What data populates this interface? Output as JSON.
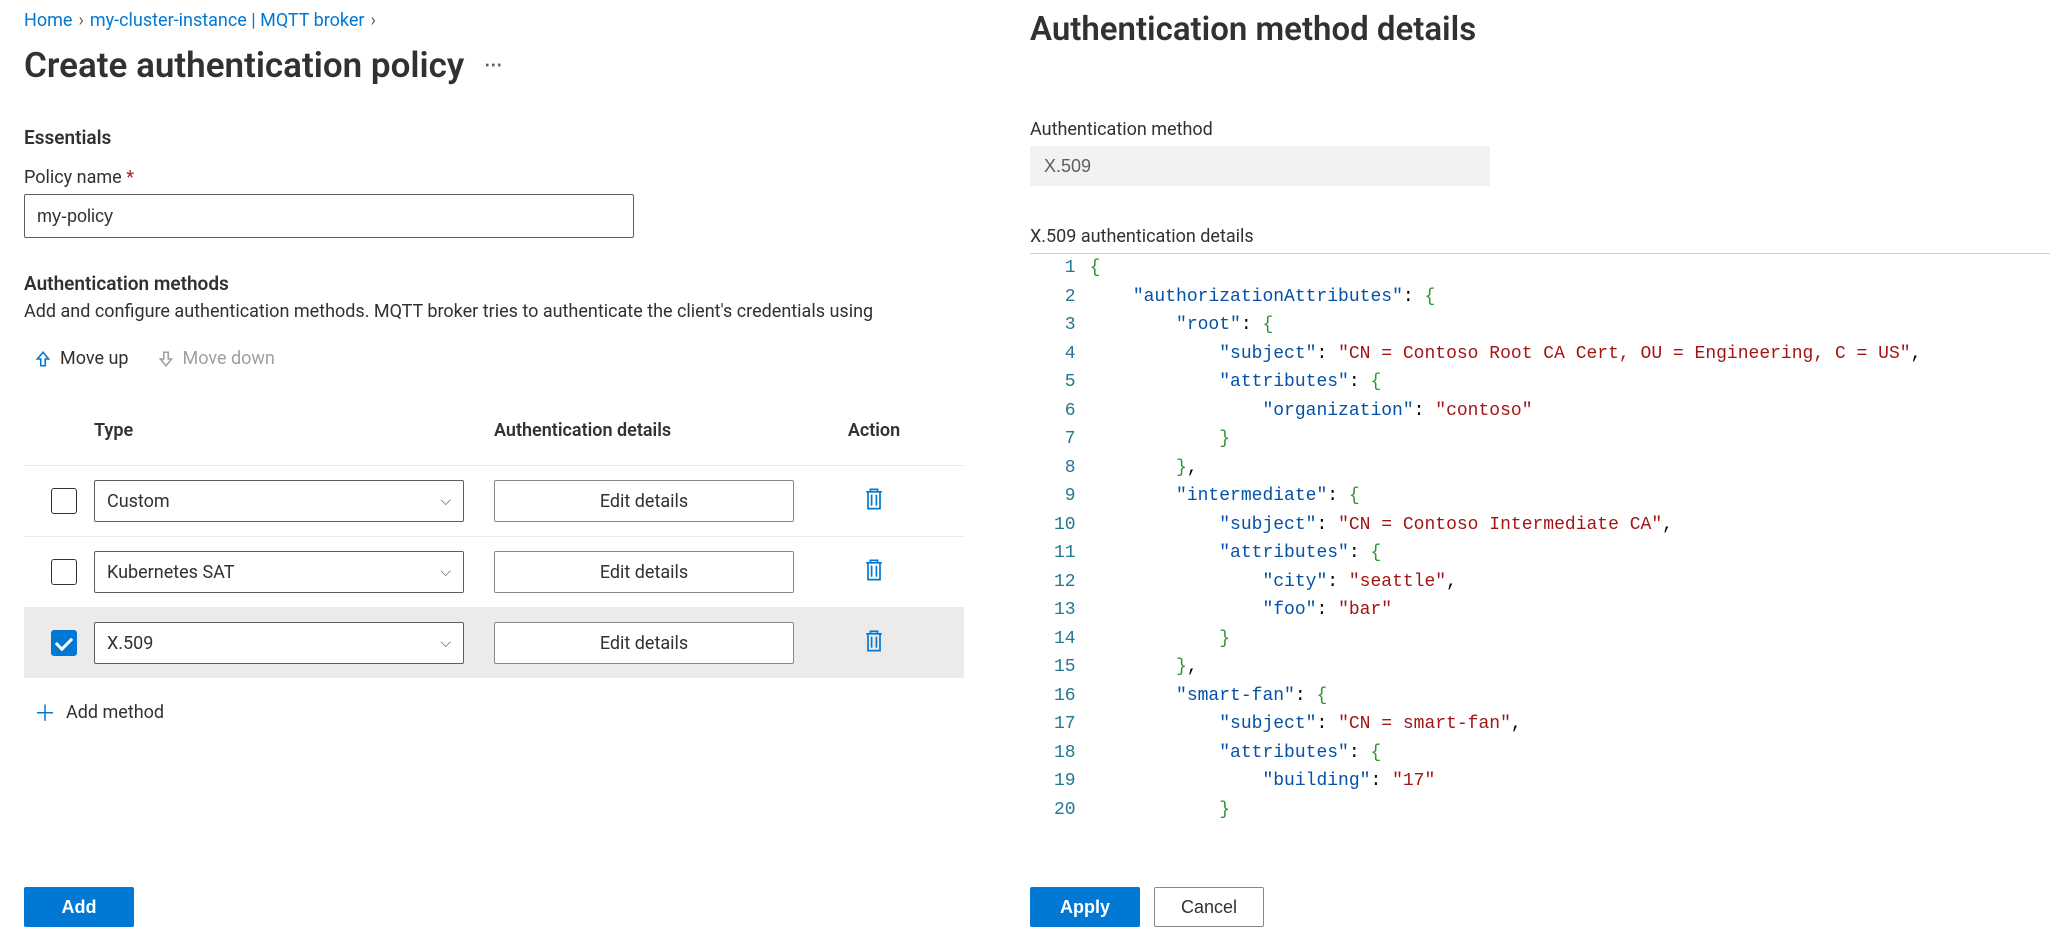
{
  "breadcrumb": {
    "home": "Home",
    "cluster": "my-cluster-instance | MQTT broker"
  },
  "page_title": "Create authentication policy",
  "essentials_heading": "Essentials",
  "policy_name_label": "Policy name",
  "policy_name_value": "my-policy",
  "auth_methods_heading": "Authentication methods",
  "auth_methods_helper": "Add and configure authentication methods. MQTT broker tries to authenticate the client's credentials using",
  "move_up_label": "Move up",
  "move_down_label": "Move down",
  "grid": {
    "col_type": "Type",
    "col_details": "Authentication details",
    "col_action": "Action",
    "edit_details": "Edit details",
    "rows": [
      {
        "type": "Custom",
        "checked": false
      },
      {
        "type": "Kubernetes SAT",
        "checked": false
      },
      {
        "type": "X.509",
        "checked": true
      }
    ]
  },
  "add_method_label": "Add method",
  "add_button": "Add",
  "right": {
    "title": "Authentication method details",
    "method_label": "Authentication method",
    "method_value": "X.509",
    "details_label": "X.509 authentication details",
    "apply": "Apply",
    "cancel": "Cancel",
    "json_lines": [
      [
        [
          "brace",
          "{"
        ]
      ],
      [
        [
          "indent",
          1
        ],
        [
          "key",
          "\"authorizationAttributes\""
        ],
        [
          "punc",
          ": "
        ],
        [
          "brace",
          "{"
        ]
      ],
      [
        [
          "indent",
          2
        ],
        [
          "key",
          "\"root\""
        ],
        [
          "punc",
          ": "
        ],
        [
          "brace",
          "{"
        ]
      ],
      [
        [
          "indent",
          3
        ],
        [
          "key",
          "\"subject\""
        ],
        [
          "punc",
          ": "
        ],
        [
          "str",
          "\"CN = Contoso Root CA Cert, OU = Engineering, C = US\""
        ],
        [
          "punc",
          ","
        ]
      ],
      [
        [
          "indent",
          3
        ],
        [
          "key",
          "\"attributes\""
        ],
        [
          "punc",
          ": "
        ],
        [
          "brace",
          "{"
        ]
      ],
      [
        [
          "indent",
          4
        ],
        [
          "key",
          "\"organization\""
        ],
        [
          "punc",
          ": "
        ],
        [
          "str",
          "\"contoso\""
        ]
      ],
      [
        [
          "indent",
          3
        ],
        [
          "brace",
          "}"
        ]
      ],
      [
        [
          "indent",
          2
        ],
        [
          "brace",
          "}"
        ],
        [
          "punc",
          ","
        ]
      ],
      [
        [
          "indent",
          2
        ],
        [
          "key",
          "\"intermediate\""
        ],
        [
          "punc",
          ": "
        ],
        [
          "brace",
          "{"
        ]
      ],
      [
        [
          "indent",
          3
        ],
        [
          "key",
          "\"subject\""
        ],
        [
          "punc",
          ": "
        ],
        [
          "str",
          "\"CN = Contoso Intermediate CA\""
        ],
        [
          "punc",
          ","
        ]
      ],
      [
        [
          "indent",
          3
        ],
        [
          "key",
          "\"attributes\""
        ],
        [
          "punc",
          ": "
        ],
        [
          "brace",
          "{"
        ]
      ],
      [
        [
          "indent",
          4
        ],
        [
          "key",
          "\"city\""
        ],
        [
          "punc",
          ": "
        ],
        [
          "str",
          "\"seattle\""
        ],
        [
          "punc",
          ","
        ]
      ],
      [
        [
          "indent",
          4
        ],
        [
          "key",
          "\"foo\""
        ],
        [
          "punc",
          ": "
        ],
        [
          "str",
          "\"bar\""
        ]
      ],
      [
        [
          "indent",
          3
        ],
        [
          "brace",
          "}"
        ]
      ],
      [
        [
          "indent",
          2
        ],
        [
          "brace",
          "}"
        ],
        [
          "punc",
          ","
        ]
      ],
      [
        [
          "indent",
          2
        ],
        [
          "key",
          "\"smart-fan\""
        ],
        [
          "punc",
          ": "
        ],
        [
          "brace",
          "{"
        ]
      ],
      [
        [
          "indent",
          3
        ],
        [
          "key",
          "\"subject\""
        ],
        [
          "punc",
          ": "
        ],
        [
          "str",
          "\"CN = smart-fan\""
        ],
        [
          "punc",
          ","
        ]
      ],
      [
        [
          "indent",
          3
        ],
        [
          "key",
          "\"attributes\""
        ],
        [
          "punc",
          ": "
        ],
        [
          "brace",
          "{"
        ]
      ],
      [
        [
          "indent",
          4
        ],
        [
          "key",
          "\"building\""
        ],
        [
          "punc",
          ": "
        ],
        [
          "str",
          "\"17\""
        ]
      ],
      [
        [
          "indent",
          3
        ],
        [
          "brace",
          "}"
        ]
      ]
    ]
  }
}
